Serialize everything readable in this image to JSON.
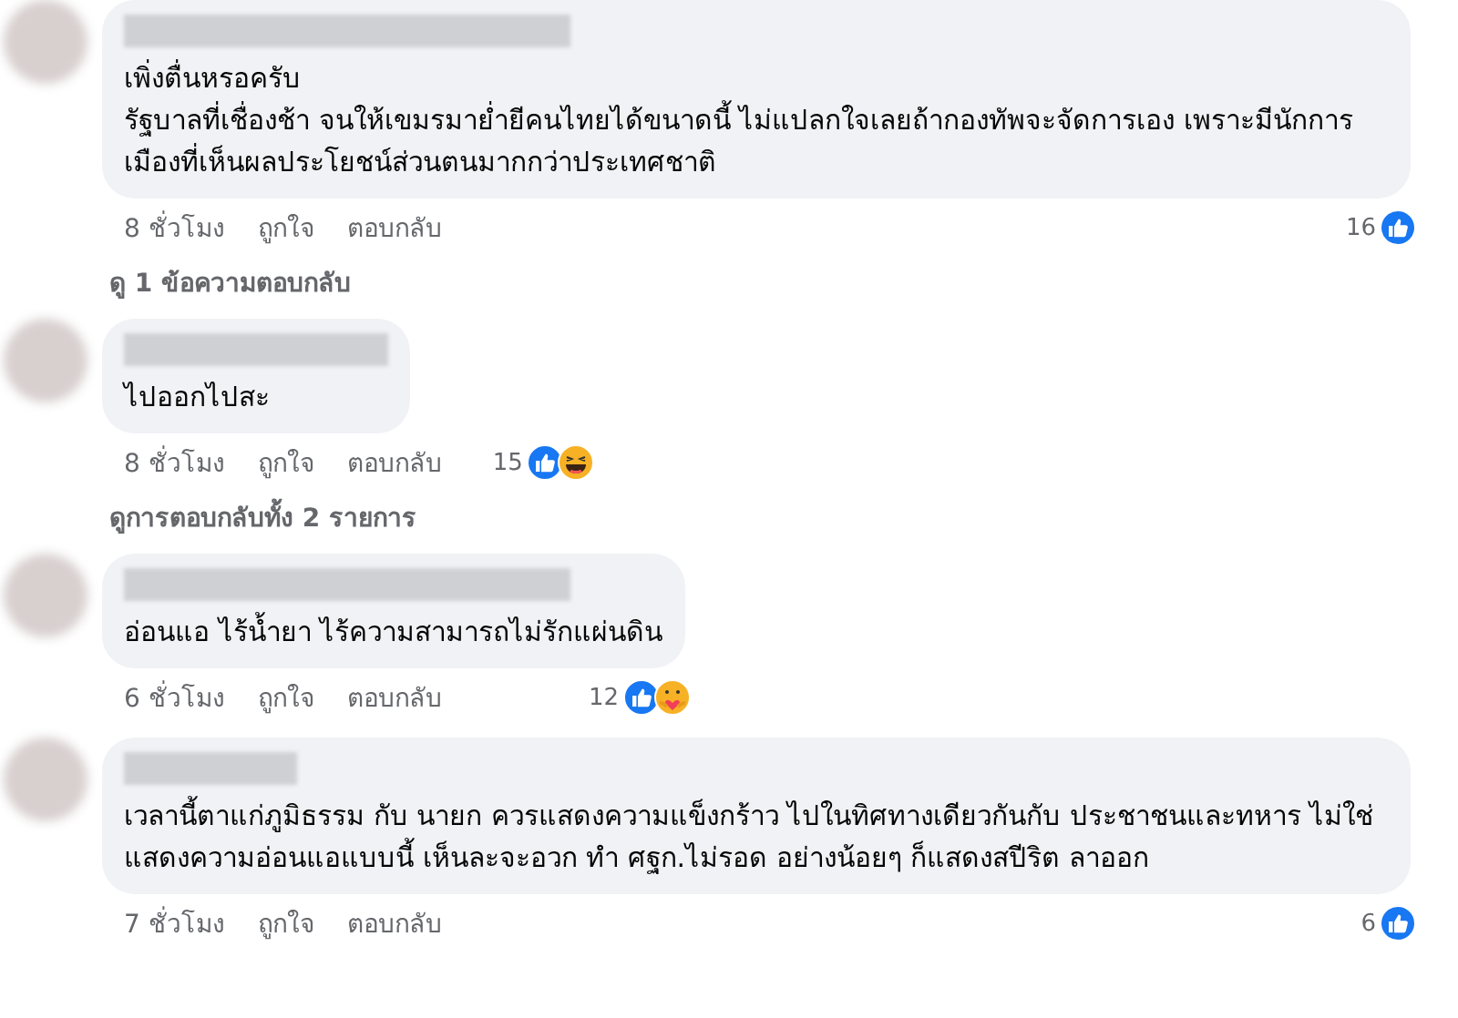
{
  "comments": [
    {
      "paragraphs": [
        "เพิ่งตื่นหรอครับ",
        "รัฐบาลที่เชื่องช้า จนให้เขมรมาย่ำยีคนไทยได้ขนาดนี้ ไม่แปลกใจเลยถ้ากองทัพจะจัดการเอง เพราะมีนักการเมืองที่เห็นผลประโยชน์ส่วนตนมากกว่าประเทศชาติ"
      ],
      "time": "8 ชั่วโมง",
      "like_label": "ถูกใจ",
      "reply_label": "ตอบกลับ",
      "reaction_count": "16",
      "reactions": [
        {
          "kind": "like"
        }
      ],
      "replies_link": "ดู 1 ข้อความตอบกลับ"
    },
    {
      "paragraphs": [
        "ไปออกไปสะ"
      ],
      "time": "8 ชั่วโมง",
      "like_label": "ถูกใจ",
      "reply_label": "ตอบกลับ",
      "reaction_count": "15",
      "reactions": [
        {
          "kind": "like"
        },
        {
          "kind": "haha"
        }
      ],
      "replies_link": "ดูการตอบกลับทั้ง 2 รายการ"
    },
    {
      "paragraphs": [
        "อ่อนแอ ไร้น้ำยา ไร้ความสามารถไม่รักแผ่นดิน"
      ],
      "time": "6 ชั่วโมง",
      "like_label": "ถูกใจ",
      "reply_label": "ตอบกลับ",
      "reaction_count": "12",
      "reactions": [
        {
          "kind": "like"
        },
        {
          "kind": "care"
        }
      ]
    },
    {
      "paragraphs": [
        "เวลานี้ตาแก่ภูมิธรรม กับ นายก ควรแสดงความแข็งกร้าว ไปในทิศทางเดียวกันกับ ประชาชนและทหาร ไม่ใช่แสดงความอ่อนแอแบบนี้ เห็นละจะอวก ทำ ศฐก.ไม่รอด อย่างน้อยๆ ก็แสดงสปีริต ลาออก"
      ],
      "time": "7 ชั่วโมง",
      "like_label": "ถูกใจ",
      "reply_label": "ตอบกลับ",
      "reaction_count": "6",
      "reactions": [
        {
          "kind": "like"
        }
      ]
    }
  ]
}
